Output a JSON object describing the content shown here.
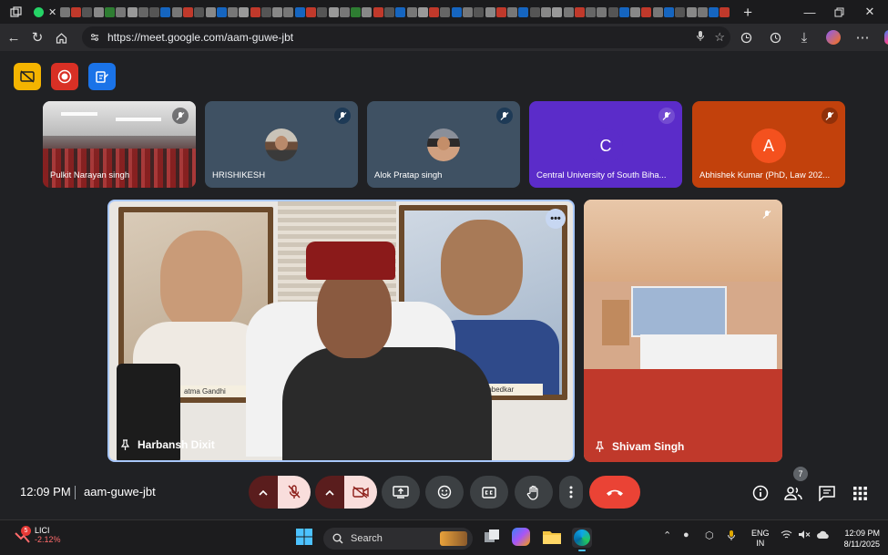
{
  "browser": {
    "url": "https://meet.google.com/aam-guwe-jbt"
  },
  "meeting": {
    "code": "aam-guwe-jbt",
    "time": "12:09 PM",
    "participant_count": "7"
  },
  "participants_strip": [
    {
      "name": "Pulkit Narayan singh",
      "type": "room",
      "bg": "#4a3a3a"
    },
    {
      "name": "HRISHIKESH",
      "type": "photo",
      "bg": "#3f5163"
    },
    {
      "name": "Alok Pratap singh",
      "type": "photo",
      "bg": "#3f5163"
    },
    {
      "name": "Central University of South Biha...",
      "type": "letter",
      "letter": "C",
      "bg": "#5b2cc9",
      "avatar_bg": "#5b2cc9"
    },
    {
      "name": "Abhishek Kumar (PhD, Law 202...",
      "type": "letter",
      "letter": "A",
      "bg": "#c2410c",
      "avatar_bg": "#f4511e"
    }
  ],
  "main_tiles": {
    "speaker": {
      "name": "Harbansh Dixit",
      "portrait_left_caption": "atma Gandhi",
      "portrait_right_caption": "R. Ambedkar"
    },
    "secondary": {
      "name": "Shivam Singh"
    }
  },
  "taskbar": {
    "stock_symbol": "LICI",
    "stock_change": "-2.12%",
    "stock_alert": "5",
    "search_label": "Search",
    "lang_line1": "ENG",
    "lang_line2": "IN",
    "time": "12:09 PM",
    "date": "8/11/2025"
  },
  "colors": {
    "accent_red": "#ea4335",
    "highlight_border": "#a8c7fa",
    "host_yellow": "#f4b400",
    "host_red": "#d93025",
    "host_blue": "#1a73e8"
  }
}
